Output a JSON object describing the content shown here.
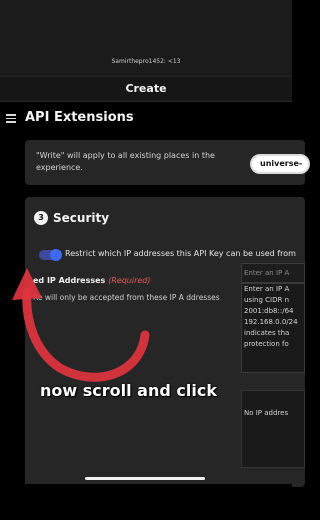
{
  "status": {
    "username": "Samirthepro1452: <13"
  },
  "header": {
    "title": "Create"
  },
  "page": {
    "title": "API Extensions"
  },
  "write_card": {
    "text": "\"Write\" will apply to all existing places in the experience.",
    "universe_button": "universe-"
  },
  "security": {
    "step": "3",
    "title": "Security",
    "toggle_on": true,
    "restrict_label": "Restrict which IP addresses this API Key can be used from",
    "allowed_label": "ed IP Addresses",
    "required": "(Required)",
    "allowed_desc": "Re      will only be accepted from these IP A      ddresses",
    "ip_input_placeholder": "Enter an IP A",
    "ip_help_lines": [
      "Enter an IP A",
      "using CIDR n",
      "2001:db8::/64",
      "192.168.0.0/24",
      "indicates tha",
      "protection fo"
    ],
    "ip_empty": "No IP addres"
  },
  "overlay": {
    "caption": "now scroll and click",
    "arrow_color": "#e0343f"
  },
  "colors": {
    "toggle": "#3d6bf5",
    "required": "#e35a5a"
  }
}
